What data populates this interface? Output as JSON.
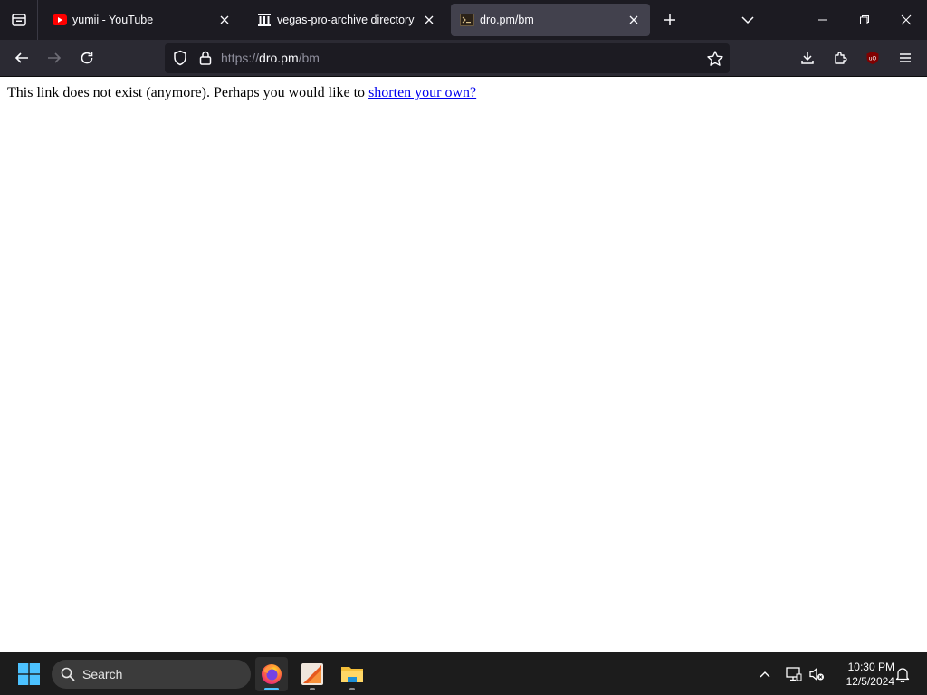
{
  "browser": {
    "tabs": [
      {
        "title": "yumii - YouTube",
        "favicon": "youtube-icon",
        "active": false
      },
      {
        "title": "vegas-pro-archive directory listing",
        "favicon": "archive-org-icon",
        "active": false
      },
      {
        "title": "dro.pm/bm",
        "favicon": "terminal-icon",
        "active": true
      }
    ],
    "url": {
      "scheme": "https://",
      "host": "dro.pm",
      "path": "/bm"
    }
  },
  "page": {
    "message": "This link does not exist (anymore). Perhaps you would like to ",
    "link_text": "shorten your own?"
  },
  "taskbar": {
    "search_label": "Search",
    "time": "10:30 PM",
    "date": "12/5/2024"
  },
  "colors": {
    "tab_strip_bg": "#1c1b22",
    "toolbar_bg": "#2b2a33",
    "active_tab_bg": "#42414d",
    "link": "#0000ee",
    "taskbar_bg": "#1c1c1c",
    "windows_accent": "#4cc2ff"
  }
}
